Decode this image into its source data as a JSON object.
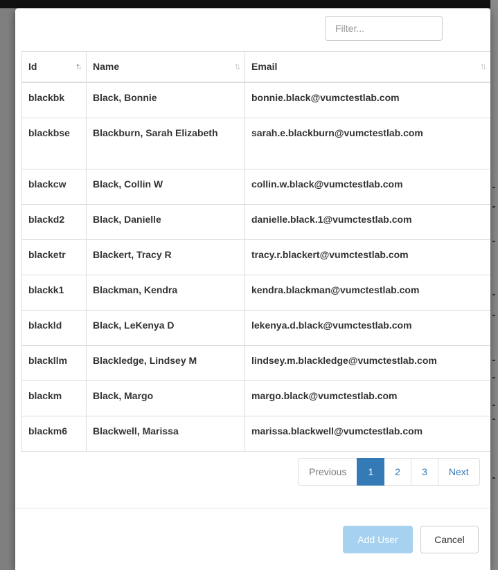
{
  "filter": {
    "placeholder": "Filter..."
  },
  "table": {
    "columns": [
      {
        "label": "Id"
      },
      {
        "label": "Name"
      },
      {
        "label": "Email"
      }
    ],
    "rows": [
      {
        "id": "blackbk",
        "name": "Black, Bonnie",
        "email": "bonnie.black@vumctestlab.com"
      },
      {
        "id": "blackbse",
        "name": "Blackburn, Sarah Elizabeth",
        "email": "sarah.e.blackburn@vumctestlab.com"
      },
      {
        "id": "blackcw",
        "name": "Black, Collin W",
        "email": "collin.w.black@vumctestlab.com"
      },
      {
        "id": "blackd2",
        "name": "Black, Danielle",
        "email": "danielle.black.1@vumctestlab.com"
      },
      {
        "id": "blacketr",
        "name": "Blackert, Tracy R",
        "email": "tracy.r.blackert@vumctestlab.com"
      },
      {
        "id": "blackk1",
        "name": "Blackman, Kendra",
        "email": "kendra.blackman@vumctestlab.com"
      },
      {
        "id": "blackld",
        "name": "Black, LeKenya D",
        "email": "lekenya.d.black@vumctestlab.com"
      },
      {
        "id": "blackllm",
        "name": "Blackledge, Lindsey M",
        "email": "lindsey.m.blackledge@vumctestlab.com"
      },
      {
        "id": "blackm",
        "name": "Black, Margo",
        "email": "margo.black@vumctestlab.com"
      },
      {
        "id": "blackm6",
        "name": "Blackwell, Marissa",
        "email": "marissa.blackwell@vumctestlab.com"
      }
    ]
  },
  "pagination": {
    "previous": "Previous",
    "pages": [
      "1",
      "2",
      "3"
    ],
    "active_page": "1",
    "next": "Next"
  },
  "footer": {
    "add_user": "Add User",
    "cancel": "Cancel"
  },
  "colors": {
    "accent": "#337ab7",
    "primary_disabled": "#a6d2f0"
  }
}
